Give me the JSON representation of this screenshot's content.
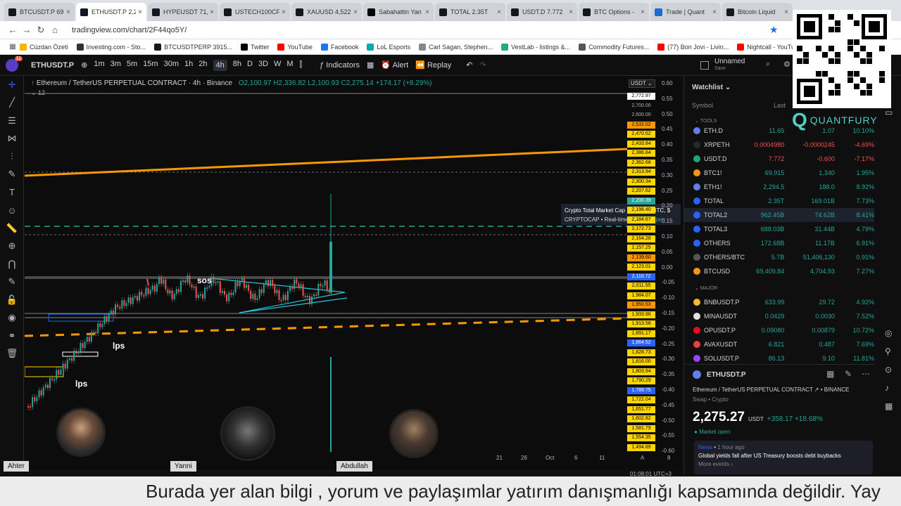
{
  "browser": {
    "tabs": [
      {
        "title": "BTCUSDT.P 69,",
        "color": "#131722",
        "active": false
      },
      {
        "title": "ETHUSDT.P 2,2",
        "color": "#131722",
        "active": true
      },
      {
        "title": "HYPEUSDT 71,",
        "color": "#131722",
        "active": false
      },
      {
        "title": "USTECH100CF",
        "color": "#131722",
        "active": false
      },
      {
        "title": "XAUUSD 4,522",
        "color": "#131722",
        "active": false
      },
      {
        "title": "Sabahattin Yan",
        "color": "#000000",
        "active": false
      },
      {
        "title": "TOTAL 2.35T",
        "color": "#131722",
        "active": false
      },
      {
        "title": "USDT.D 7.772",
        "color": "#131722",
        "active": false
      },
      {
        "title": "BTC Options -",
        "color": "#131722",
        "active": false
      },
      {
        "title": "Trade | Quant",
        "color": "#1b6ad3",
        "active": false
      },
      {
        "title": "Bitcoin Liquid",
        "color": "#131722",
        "active": false
      }
    ],
    "url": "tradingview.com/chart/2F44qo5Y/",
    "bookmarks": [
      {
        "label": "Cüzdan Özeti",
        "color": "#f4b400"
      },
      {
        "label": "Investing.com - Sto...",
        "color": "#333333"
      },
      {
        "label": "BTCUSDTPERP 3915...",
        "color": "#131722"
      },
      {
        "label": "Twitter",
        "color": "#000000"
      },
      {
        "label": "YouTube",
        "color": "#ff0000"
      },
      {
        "label": "Facebook",
        "color": "#1877f2"
      },
      {
        "label": "LoL Esports",
        "color": "#0aa"
      },
      {
        "label": "Carl Sagan, Stephen...",
        "color": "#888"
      },
      {
        "label": "VestLab - listings &...",
        "color": "#2a8"
      },
      {
        "label": "Commodity Futures...",
        "color": "#555"
      },
      {
        "label": "(77) Bon Jovi - Livin...",
        "color": "#ff0000"
      },
      {
        "label": "Nightcall - YouTube",
        "color": "#ff0000"
      }
    ]
  },
  "toolbar": {
    "symbol": "ETHUSDT.P",
    "intervals": [
      "1m",
      "3m",
      "5m",
      "15m",
      "30m",
      "1h",
      "2h",
      "4h",
      "8h",
      "D",
      "3D",
      "W",
      "M"
    ],
    "active_interval": "4h",
    "indicators": "Indicators",
    "alert": "Alert",
    "replay": "Replay",
    "layout_name": "Unnamed",
    "layout_sub": "Save"
  },
  "chart": {
    "title": "Ethereum / TetherUS PERPETUAL CONTRACT · 4h · Binance",
    "ohlc": "O2,100.97 H2,336.82 L2,100.93 C2,275.14 +174.17 (+8.29%)",
    "num": "12",
    "currency": "USDT",
    "labels": {
      "sos": "sos",
      "lps1": "lps",
      "lps2": "lps"
    },
    "tooltip": {
      "line1": "Crypto Total Market Cap Excluding BTC, $",
      "line2a": "CRYPTOCAP",
      "line2b": "Real-time",
      "line2c": "Market open"
    },
    "price_tags": [
      "2,772.97",
      "2,700.00",
      "2,600.00",
      "2,532.02",
      "2,470.52",
      "2,433.84",
      "2,386.84",
      "2,362.68",
      "2,313.94",
      "2,300.34",
      "2,207.62",
      "2,200.39",
      "2,198.40",
      "2,184.67",
      "2,172.73",
      "2,164.28",
      "2,157.25",
      "2,139.60",
      "2,123.01",
      "2,110.72",
      "2,011.55",
      "1,984.07",
      "1,950.53",
      "1,933.96",
      "1,913.58",
      "1,891.17",
      "1,864.52",
      "1,828.73",
      "1,816.00",
      "1,803.94",
      "1,790.29",
      "1,789.75",
      "1,722.04",
      "1,651.77",
      "1,602.82",
      "1,581.79",
      "1,554.35",
      "1,494.89"
    ],
    "right_axis": [
      "0.60",
      "0.55",
      "0.50",
      "0.45",
      "0.40",
      "0.35",
      "0.30",
      "0.25",
      "0.20",
      "0.15",
      "0.10",
      "0.05",
      "0.00",
      "-0.05",
      "-0.10",
      "-0.15",
      "-0.20",
      "-0.25",
      "-0.30",
      "-0.35",
      "-0.40",
      "-0.45",
      "-0.50",
      "-0.55",
      "-0.60"
    ],
    "time_axis": [
      "21",
      "26",
      "Oct",
      "6",
      "11"
    ],
    "time_right": "A",
    "time_far": "8",
    "clock": "01:08:01 UTC+3"
  },
  "watchlist": {
    "title": "Watchlist",
    "col_symbol": "Symbol",
    "col_last": "Last",
    "section_tools": "TOOLS",
    "section_major": "MAJÖR",
    "rows": [
      {
        "sym": "ETH.D",
        "last": "11.65",
        "chg": "1.07",
        "pct": "10.10%",
        "dir": "pos",
        "icon": "#627eea"
      },
      {
        "sym": "XRPETH",
        "last": "0.0004980",
        "chg": "-0.0000245",
        "pct": "-4.69%",
        "dir": "neg",
        "icon": "#23292f"
      },
      {
        "sym": "USDT.D",
        "last": "7.772",
        "chg": "-0.600",
        "pct": "-7.17%",
        "dir": "neg",
        "icon": "#26a17b"
      },
      {
        "sym": "BTC1!",
        "last": "69,915",
        "chg": "1,340",
        "pct": "1.95%",
        "dir": "pos",
        "icon": "#f7931a"
      },
      {
        "sym": "ETH1!",
        "last": "2,294.5",
        "chg": "188.0",
        "pct": "8.92%",
        "dir": "pos",
        "icon": "#627eea"
      },
      {
        "sym": "TOTAL",
        "last": "2.35T",
        "chg": "169.01B",
        "pct": "7.73%",
        "dir": "pos",
        "icon": "#2962ff"
      },
      {
        "sym": "TOTAL2",
        "last": "962.45B",
        "chg": "74.62B",
        "pct": "8.41%",
        "dir": "pos",
        "icon": "#2962ff"
      },
      {
        "sym": "TOTAL3",
        "last": "688.03B",
        "chg": "31.44B",
        "pct": "4.79%",
        "dir": "pos",
        "icon": "#2962ff"
      },
      {
        "sym": "OTHERS",
        "last": "172.68B",
        "chg": "11.17B",
        "pct": "6.91%",
        "dir": "pos",
        "icon": "#2962ff"
      },
      {
        "sym": "OTHERS/BTC",
        "last": "5.7B",
        "chg": "51,406,130",
        "pct": "0.91%",
        "dir": "pos",
        "icon": "#555"
      },
      {
        "sym": "BTCUSD",
        "last": "69,409.84",
        "chg": "4,704.93",
        "pct": "7.27%",
        "dir": "pos",
        "icon": "#f7931a"
      },
      {
        "sym": "BNBUSDT.P",
        "last": "633.99",
        "chg": "29.72",
        "pct": "4.92%",
        "dir": "pos",
        "icon": "#f3ba2f"
      },
      {
        "sym": "MINAUSDT",
        "last": "0.0429",
        "chg": "0.0030",
        "pct": "7.52%",
        "dir": "pos",
        "icon": "#e0e0e0"
      },
      {
        "sym": "OPUSDT.P",
        "last": "0.09080",
        "chg": "0.00879",
        "pct": "10.72%",
        "dir": "pos",
        "icon": "#ff0420"
      },
      {
        "sym": "AVAXUSDT",
        "last": "6.821",
        "chg": "0.487",
        "pct": "7.69%",
        "dir": "pos",
        "icon": "#e84142"
      },
      {
        "sym": "SOLUSDT.P",
        "last": "86.13",
        "chg": "9.10",
        "pct": "11.81%",
        "dir": "pos",
        "icon": "#9945ff"
      }
    ],
    "detail": {
      "symbol": "ETHUSDT.P",
      "name": "Ethereum / TetherUS PERPETUAL CONTRACT",
      "exchange": "BINANCE",
      "type": "Swap • Crypto",
      "price_big": "2,275",
      "price_small": ".27",
      "currency": "USDT",
      "change": "+358.17 +18.68%",
      "status": "Market open",
      "news_tag": "News",
      "news_time": "1 hour ago",
      "news_text": "Global yields fall after US Treasury boosts debt buybacks",
      "news_more": "More events"
    }
  },
  "overlay": {
    "brand": "QUANTFURY",
    "participants": [
      "Ahter",
      "Yanni",
      "Abdullah"
    ],
    "subtitle": "Burada yer alan bilgi , yorum ve paylaşımlar yatırım danışmanlığı kapsamında değildir. Yay"
  },
  "colors": {
    "up": "#26a69a",
    "down": "#ef5350",
    "accent": "#2962ff",
    "tag": "#ffd600",
    "orange": "#ff9800"
  }
}
